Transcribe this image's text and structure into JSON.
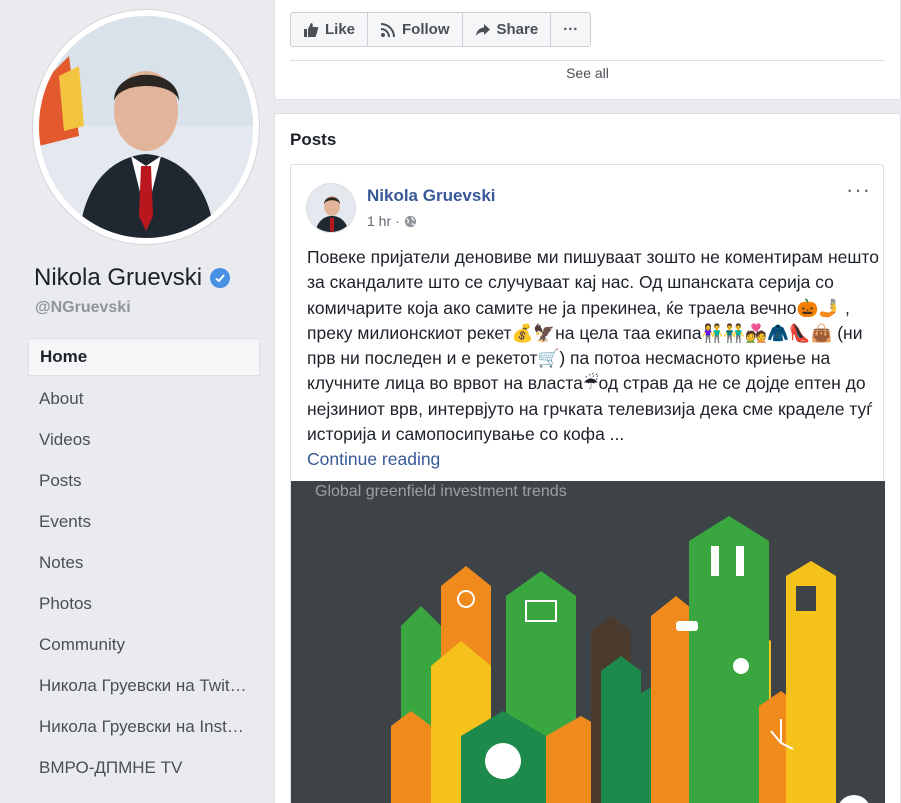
{
  "profile": {
    "name": "Nikola Gruevski",
    "handle": "@NGruevski"
  },
  "nav": {
    "items": [
      {
        "label": "Home",
        "active": true
      },
      {
        "label": "About"
      },
      {
        "label": "Videos"
      },
      {
        "label": "Posts"
      },
      {
        "label": "Events"
      },
      {
        "label": "Notes"
      },
      {
        "label": "Photos"
      },
      {
        "label": "Community"
      },
      {
        "label": "Никола Груевски на Twit…"
      },
      {
        "label": "Никола Груевски на Inst…"
      },
      {
        "label": "ВМРО-ДПМНЕ TV"
      }
    ]
  },
  "actions": {
    "like": "Like",
    "follow": "Follow",
    "share": "Share",
    "more": "···",
    "see_all": "See all"
  },
  "posts": {
    "title": "Posts",
    "post": {
      "author": "Nikola Gruevski",
      "time": "1 hr",
      "sep": "·",
      "text": "Повеке пријатели деновиве ми пишуваат зошто не коментирам нешто за скандалите што се случуваат кај нас. Од шпанската серија со комичарите која ако самите не ја прекинеа, ќе траела вечно🎃🤳 , преку милионскиот рекет💰🦅на цела таа екипа👫👬💑🧥👠👜 (ни прв ни последен и е рекетот🛒) па потоа несмасното криење на клучните лица во врвот на власта☔од страв да не се дојде ептен до нејзиниот врв, интервјуто на грчката телевизија дека сме краделе туѓ историја и самопосипување со кофа ...",
      "continue": "Continue reading",
      "image_caption": "Global greenfield investment trends",
      "image_info": "i"
    }
  },
  "colors": {
    "link": "#385898",
    "verified": "#4a90e2",
    "bg": "#e9ebee"
  }
}
